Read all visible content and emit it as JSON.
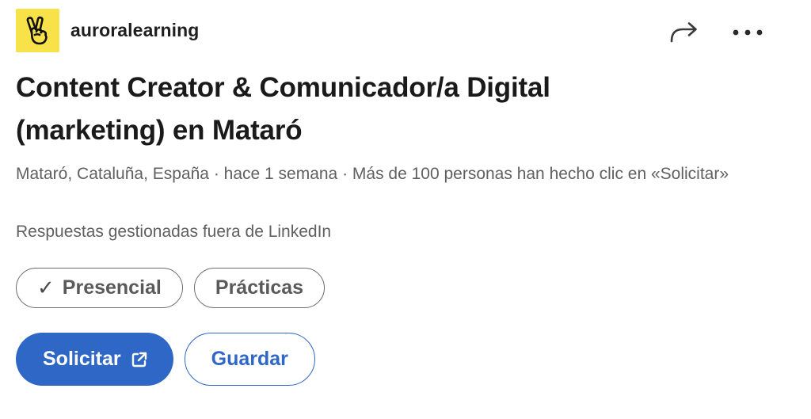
{
  "company": {
    "name": "auroralearning",
    "logo_icon": "victory-hand-icon",
    "logo_bg_color": "#f8e24a"
  },
  "header_actions": {
    "share_icon": "share-arrow-icon",
    "more_icon": "more-dots-icon"
  },
  "job": {
    "title": "Content Creator & Comunicador/a Digital (marketing) en Mataró",
    "meta": "Mataró, Cataluña, España · hace 1 semana · Más de 100 personas han hecho clic en «Solicitar»",
    "applications_note": "Respuestas gestionadas fuera de LinkedIn"
  },
  "chips": {
    "workplace": {
      "check_glyph": "✓",
      "label": "Presencial"
    },
    "type": {
      "label": "Prácticas"
    }
  },
  "actions": {
    "apply_label": "Solicitar",
    "apply_icon": "external-link-icon",
    "save_label": "Guardar",
    "accent_color": "#2f67c6"
  }
}
